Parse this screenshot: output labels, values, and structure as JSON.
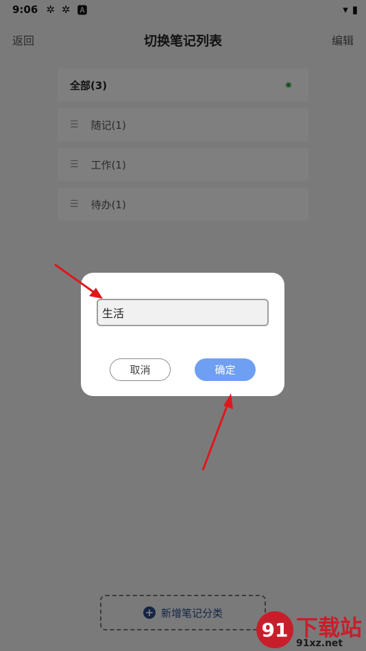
{
  "status_bar": {
    "time": "9:06"
  },
  "header": {
    "back_label": "返回",
    "title": "切换笔记列表",
    "edit_label": "编辑"
  },
  "categories": {
    "items": [
      {
        "label": "全部(3)",
        "selected": true
      },
      {
        "label": "随记(1)"
      },
      {
        "label": "工作(1)"
      },
      {
        "label": "待办(1)"
      }
    ]
  },
  "add_category": {
    "label": "新增笔记分类"
  },
  "dialog": {
    "input_value": "生活",
    "cancel_label": "取消",
    "confirm_label": "确定"
  },
  "watermark": {
    "logo_text": "91",
    "name": "下载站",
    "domain": "91xz.net"
  },
  "colors": {
    "selected_dot": "#2e9d3a",
    "confirm_button": "#6f9ff2",
    "add_button_text": "#2b4b8a",
    "annotation_arrow": "#e0161b"
  }
}
